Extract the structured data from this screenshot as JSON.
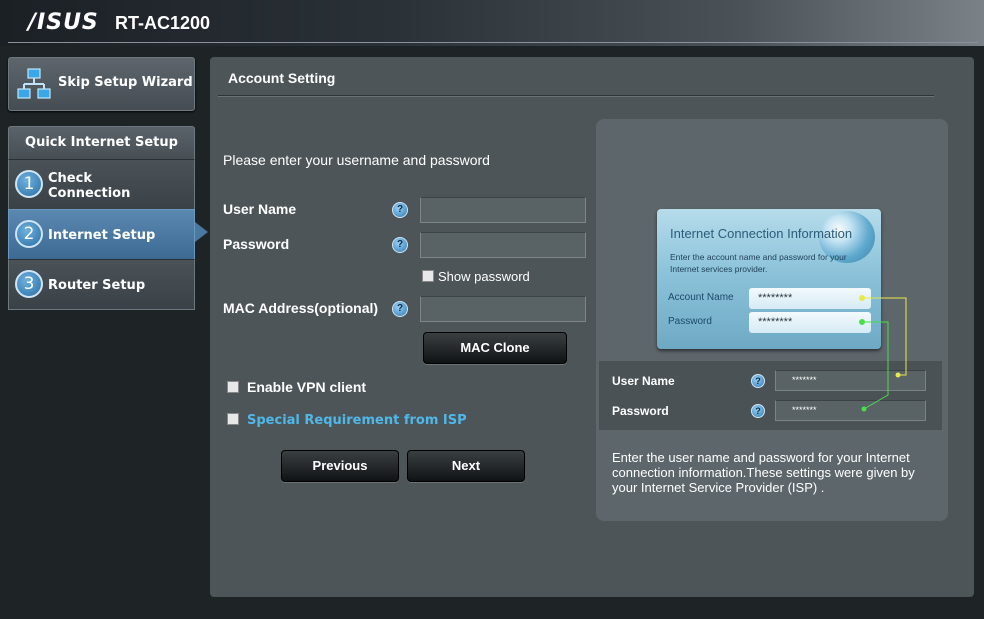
{
  "header": {
    "brand": "/ISUS",
    "model": "RT-AC1200"
  },
  "sidebar": {
    "skip_label": "Skip Setup Wizard",
    "section_title": "Quick Internet Setup",
    "steps": [
      {
        "num": "1",
        "label_line1": "Check",
        "label_line2": "Connection"
      },
      {
        "num": "2",
        "label": "Internet Setup",
        "active": true
      },
      {
        "num": "3",
        "label": "Router Setup"
      }
    ]
  },
  "main": {
    "title": "Account Setting",
    "prompt": "Please enter your username and password",
    "username_label": "User Name",
    "username_value": "",
    "password_label": "Password",
    "password_value": "",
    "show_password_label": "Show password",
    "mac_label": "MAC Address(optional)",
    "mac_value": "",
    "help_glyph": "?",
    "mac_clone_label": "MAC Clone",
    "vpn_label": "Enable VPN client",
    "isp_label": "Special Requirement from ISP",
    "previous_label": "Previous",
    "next_label": "Next"
  },
  "info": {
    "card_title": "Internet Connection Information",
    "card_desc": "Enter the account name and password for your Internet services provider.",
    "card_account_label": "Account Name",
    "card_account_value": "********",
    "card_password_label": "Password",
    "card_password_value": "********",
    "mini_user_label": "User Name",
    "mini_user_value": "*******",
    "mini_pass_label": "Password",
    "mini_pass_value": "*******",
    "text": "Enter the user name and password for your Internet connection information.These settings were given by your Internet Service Provider (ISP) ."
  },
  "colors": {
    "accent_blue": "#3d6a92",
    "link_blue": "#4fb8e8",
    "connector_yellow": "#e8e84a",
    "connector_green": "#4ade4a",
    "panel_bg": "#4d5558"
  }
}
